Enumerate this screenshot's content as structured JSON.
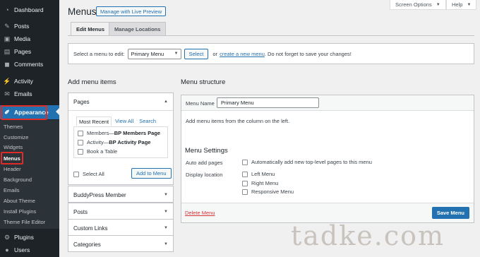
{
  "sidebar": {
    "items": [
      {
        "label": "Dashboard",
        "icon": "dashboard-icon"
      },
      {
        "label": "Posts",
        "icon": "pin-icon"
      },
      {
        "label": "Media",
        "icon": "media-icon"
      },
      {
        "label": "Pages",
        "icon": "page-icon"
      },
      {
        "label": "Comments",
        "icon": "comment-icon"
      },
      {
        "label": "Activity",
        "icon": "activity-icon"
      },
      {
        "label": "Emails",
        "icon": "email-icon"
      },
      {
        "label": "Appearance",
        "icon": "brush-icon"
      },
      {
        "label": "Plugins",
        "icon": "plugin-icon"
      },
      {
        "label": "Users",
        "icon": "users-icon"
      }
    ],
    "submenu": [
      "Themes",
      "Customize",
      "Widgets",
      "Menus",
      "Header",
      "Background",
      "Emails",
      "About Theme",
      "Install Plugins",
      "Theme File Editor"
    ]
  },
  "top": {
    "screen_options": "Screen Options",
    "help": "Help"
  },
  "header": {
    "title": "Menus",
    "live_preview": "Manage with Live Preview"
  },
  "tabs": {
    "edit": "Edit Menus",
    "locations": "Manage Locations"
  },
  "select_bar": {
    "prefix": "Select a menu to edit:",
    "selected": "Primary Menu",
    "button": "Select",
    "or": "or",
    "create_link": "create a new menu",
    "suffix": ". Do not forget to save your changes!"
  },
  "add_items": {
    "heading": "Add menu items",
    "pages_title": "Pages",
    "page_tabs": [
      "Most Recent",
      "View All",
      "Search"
    ],
    "pages": [
      {
        "name": "Members",
        "sep": " — ",
        "tag": "BP Members Page"
      },
      {
        "name": "Activity",
        "sep": " — ",
        "tag": "BP Activity Page"
      },
      {
        "name": "Book a Table",
        "sep": "",
        "tag": ""
      }
    ],
    "select_all": "Select All",
    "add_to_menu": "Add to Menu",
    "sections": [
      "BuddyPress Member",
      "Posts",
      "Custom Links",
      "Categories"
    ]
  },
  "structure": {
    "heading": "Menu structure",
    "menu_name_label": "Menu Name",
    "menu_name_value": "Primary Menu",
    "instructions": "Add menu items from the column on the left.",
    "settings_heading": "Menu Settings",
    "auto_add_label": "Auto add pages",
    "auto_add_text": "Automatically add new top-level pages to this menu",
    "display_location_label": "Display location",
    "locations": [
      "Left Menu",
      "Right Menu",
      "Responsive Menu"
    ],
    "delete": "Delete Menu",
    "save": "Save Menu"
  },
  "watermark": "tadke.com",
  "colors": {
    "accent": "#2271b1",
    "highlight": "#e02b27",
    "sidebar": "#1d2327",
    "delete": "#d63638"
  }
}
